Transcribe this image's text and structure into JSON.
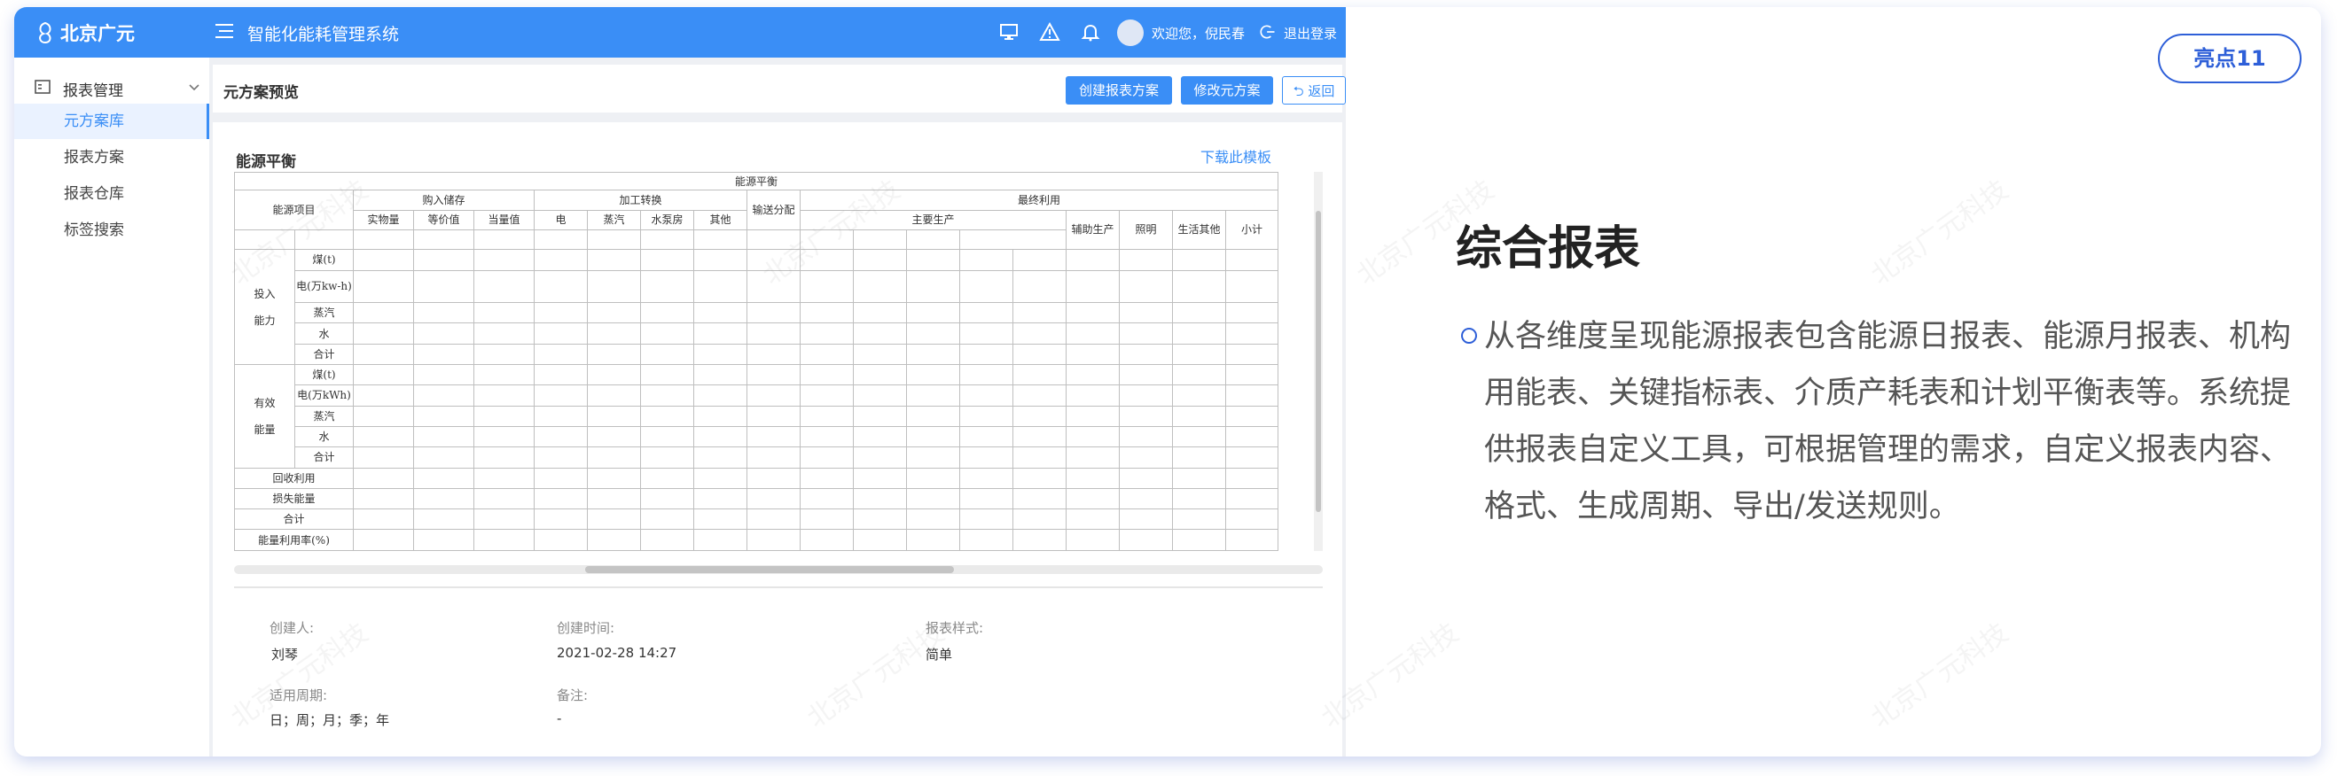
{
  "app": {
    "logo_text": "北京广元",
    "system_title": "智能化能耗管理系统",
    "welcome": "欢迎您，倪民春",
    "logout": "退出登录"
  },
  "sidebar": {
    "group_label": "报表管理",
    "items": [
      {
        "label": "元方案库",
        "active": true
      },
      {
        "label": "报表方案"
      },
      {
        "label": "报表仓库"
      },
      {
        "label": "标签搜索"
      }
    ]
  },
  "header": {
    "page_title": "元方案预览",
    "btn_create": "创建报表方案",
    "btn_edit": "修改元方案",
    "btn_back": "返回"
  },
  "panel": {
    "title": "能源平衡",
    "download": "下载此模板"
  },
  "table": {
    "title": "能源平衡",
    "col_energy_item": "能源项目",
    "col_purchase": "购入储存",
    "col_process": "加工转换",
    "col_transport": "输送分配",
    "col_final": "最终利用",
    "sub_purchase": [
      "实物量",
      "等价值",
      "当量值"
    ],
    "sub_process": [
      "电",
      "蒸汽",
      "水泵房",
      "其他"
    ],
    "sub_main": "主要生产",
    "sub_aux": "辅助生产",
    "sub_light": "照明",
    "sub_life": "生活其他",
    "sub_total": "小计",
    "group_input": "投入能力",
    "input_rows": [
      "煤(t)",
      "电(万kw-h)",
      "蒸汽",
      "水",
      "合计"
    ],
    "group_effective": "有效能量",
    "effective_rows": [
      "煤(t)",
      "电(万kWh)",
      "蒸汽",
      "水",
      "合计"
    ],
    "recycle": "回收利用",
    "loss": "损失能量",
    "total": "合计",
    "utilization": "能量利用率(%)"
  },
  "meta": {
    "creator_label": "创建人:",
    "creator": "刘琴",
    "created_label": "创建时间:",
    "created": "2021-02-28 14:27",
    "style_label": "报表样式:",
    "style": "简单",
    "period_label": "适用周期:",
    "period": "日；周；月；季；年",
    "remark_label": "备注:",
    "remark": "-"
  },
  "watermark": "北京广元科技",
  "right": {
    "badge": "亮点11",
    "heading": "综合报表",
    "paragraph": "从各维度呈现能源报表包含能源日报表、能源月报表、机构用能表、关键指标表、介质产耗表和计划平衡表等。系统提供报表自定义工具，可根据管理的需求，自定义报表内容、格式、生成周期、导出/发送规则。"
  },
  "colors": {
    "primary": "#3a8ef6",
    "accent": "#2e5fd8"
  }
}
